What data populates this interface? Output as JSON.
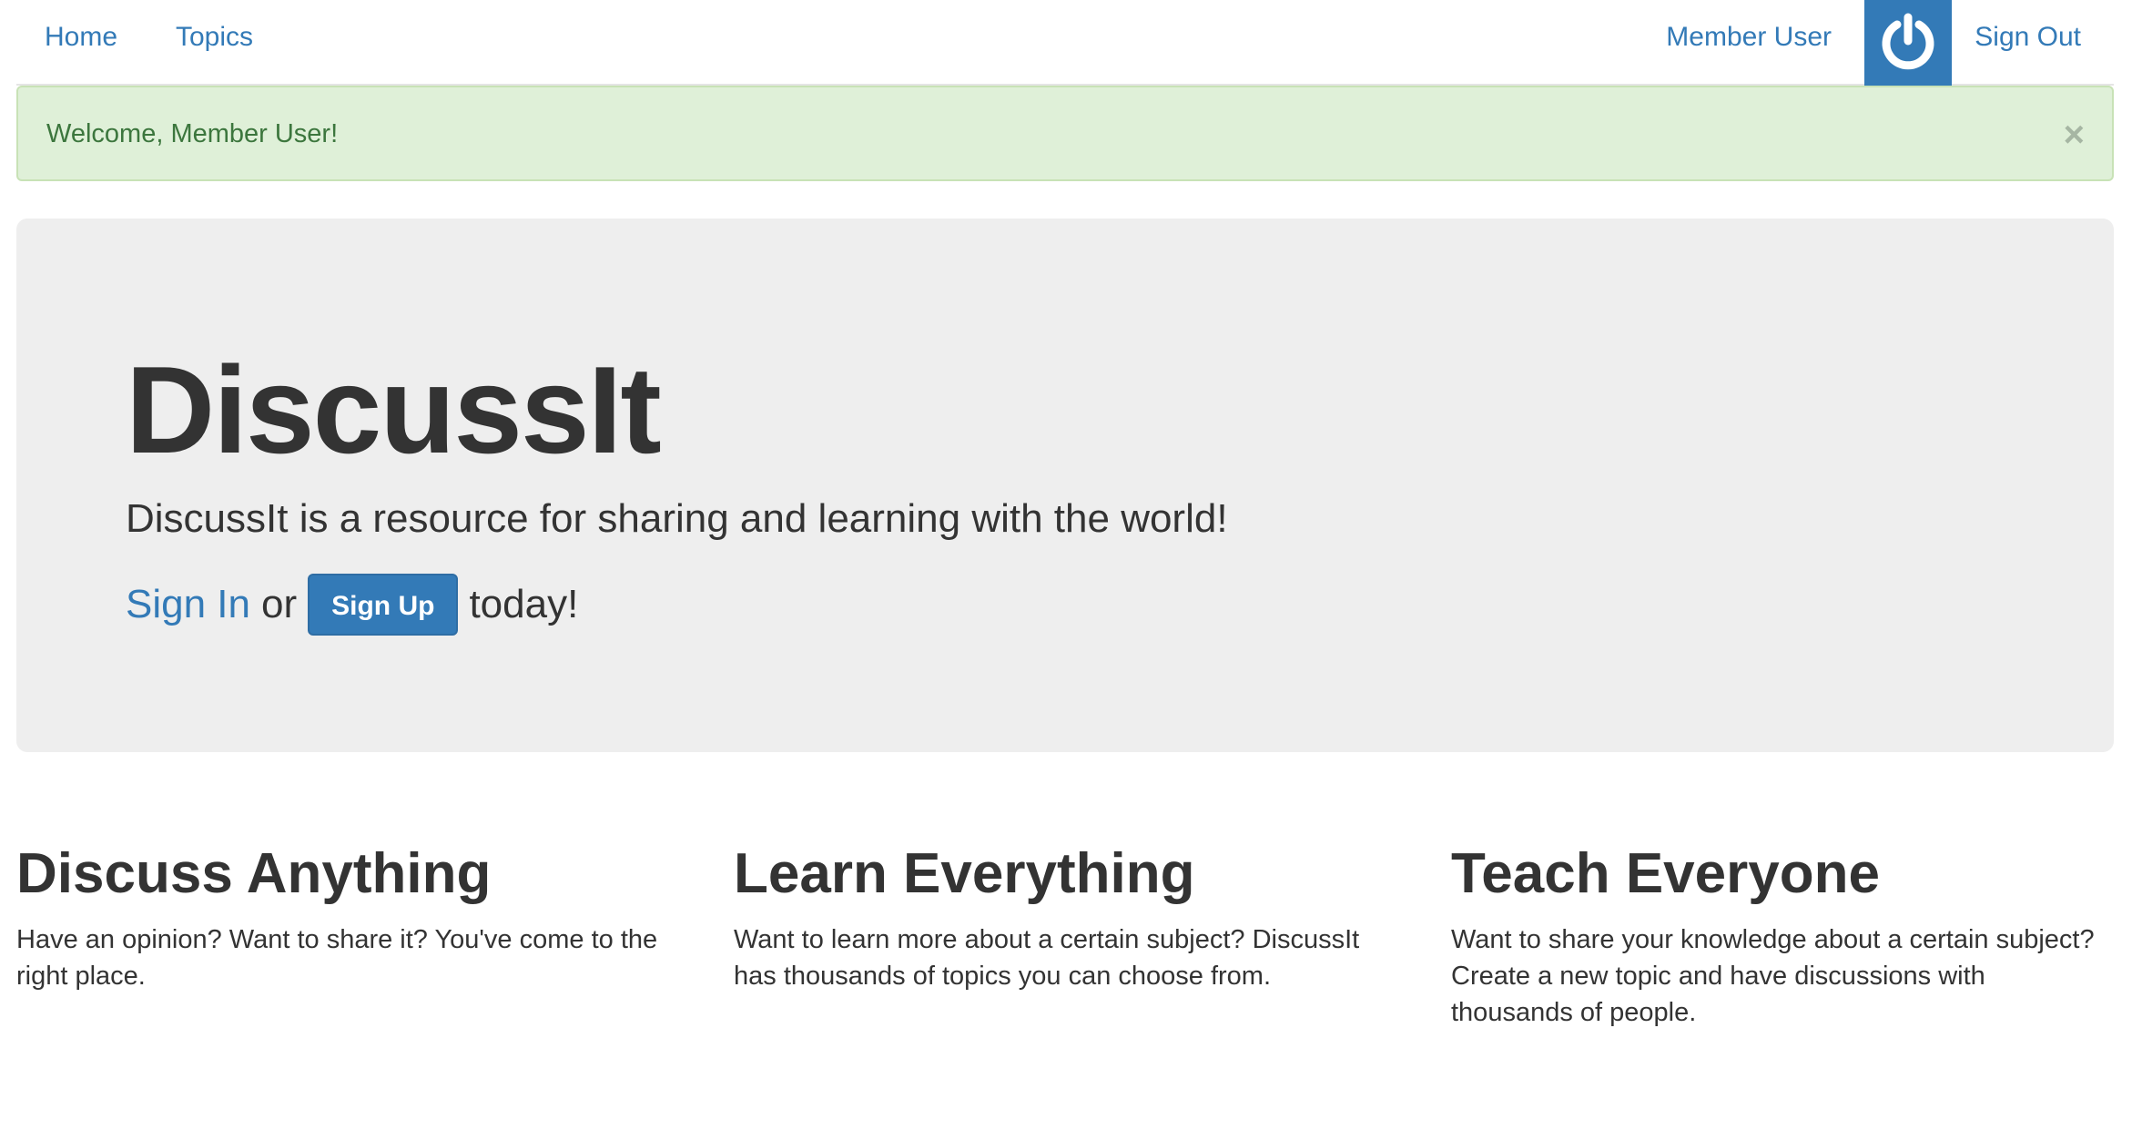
{
  "navbar": {
    "home_label": "Home",
    "topics_label": "Topics",
    "user_label": "Member User",
    "avatar_icon": "power-icon",
    "signout_label": "Sign Out"
  },
  "alert": {
    "message": "Welcome, Member User!",
    "close_label": "×"
  },
  "hero": {
    "title": "DiscussIt",
    "lead": "DiscussIt is a resource for sharing and learning with the world!",
    "signin_label": "Sign In",
    "or_text": "or",
    "signup_label": "Sign Up",
    "today_text": "today!"
  },
  "features": [
    {
      "heading": "Discuss Anything",
      "text": "Have an opinion? Want to share it? You've come to the right place."
    },
    {
      "heading": "Learn Everything",
      "text": "Want to learn more about a certain subject? DiscussIt has thousands of topics you can choose from."
    },
    {
      "heading": "Teach Everyone",
      "text": "Want to share your knowledge about a certain subject? Create a new topic and have discussions with thousands of people."
    }
  ],
  "colors": {
    "accent": "#337ab7",
    "alert_bg": "#dff0d8",
    "alert_text": "#3c763d",
    "jumbotron_bg": "#eeeeee"
  }
}
